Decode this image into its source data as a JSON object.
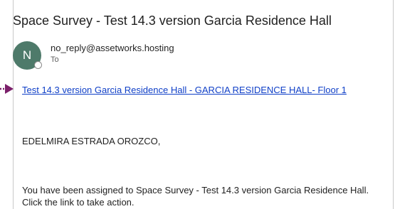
{
  "email": {
    "subject": "Space Survey - Test 14.3 version Garcia Residence Hall",
    "sender": {
      "avatar_initial": "N",
      "avatar_color": "#4e7a6a",
      "address": "no_reply@assetworks.hosting",
      "recipient_label": "To"
    },
    "link": {
      "text": "Test 14.3 version Garcia Residence Hall - GARCIA RESIDENCE HALL- Floor 1",
      "color": "#0f3fc7"
    },
    "greeting": "EDELMIRA ESTRADA OROZCO,",
    "body_line_1": "You have been assigned to Space Survey - Test 14.3 version Garcia Residence Hall.",
    "body_line_2": "Click the link to take action."
  },
  "annotation": {
    "arrow_color": "#7b1f6a",
    "arrow_icon": "pointer-arrow-icon"
  }
}
